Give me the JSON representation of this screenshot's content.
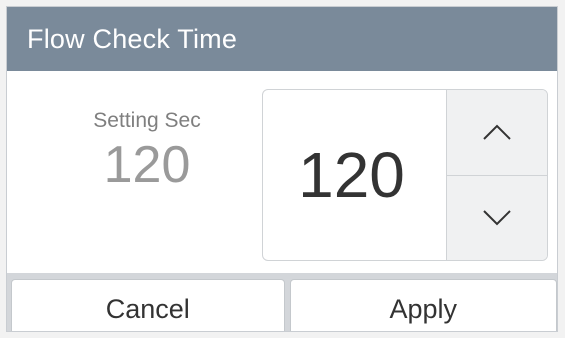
{
  "dialog": {
    "title": "Flow Check Time"
  },
  "setting": {
    "label": "Setting Sec",
    "value": "120"
  },
  "spinner": {
    "value": "120",
    "up_icon": "chevron-up-icon",
    "down_icon": "chevron-down-icon"
  },
  "footer": {
    "cancel_label": "Cancel",
    "apply_label": "Apply"
  },
  "colors": {
    "titlebar": "#7a8a9a",
    "footer": "#d3d6da"
  }
}
